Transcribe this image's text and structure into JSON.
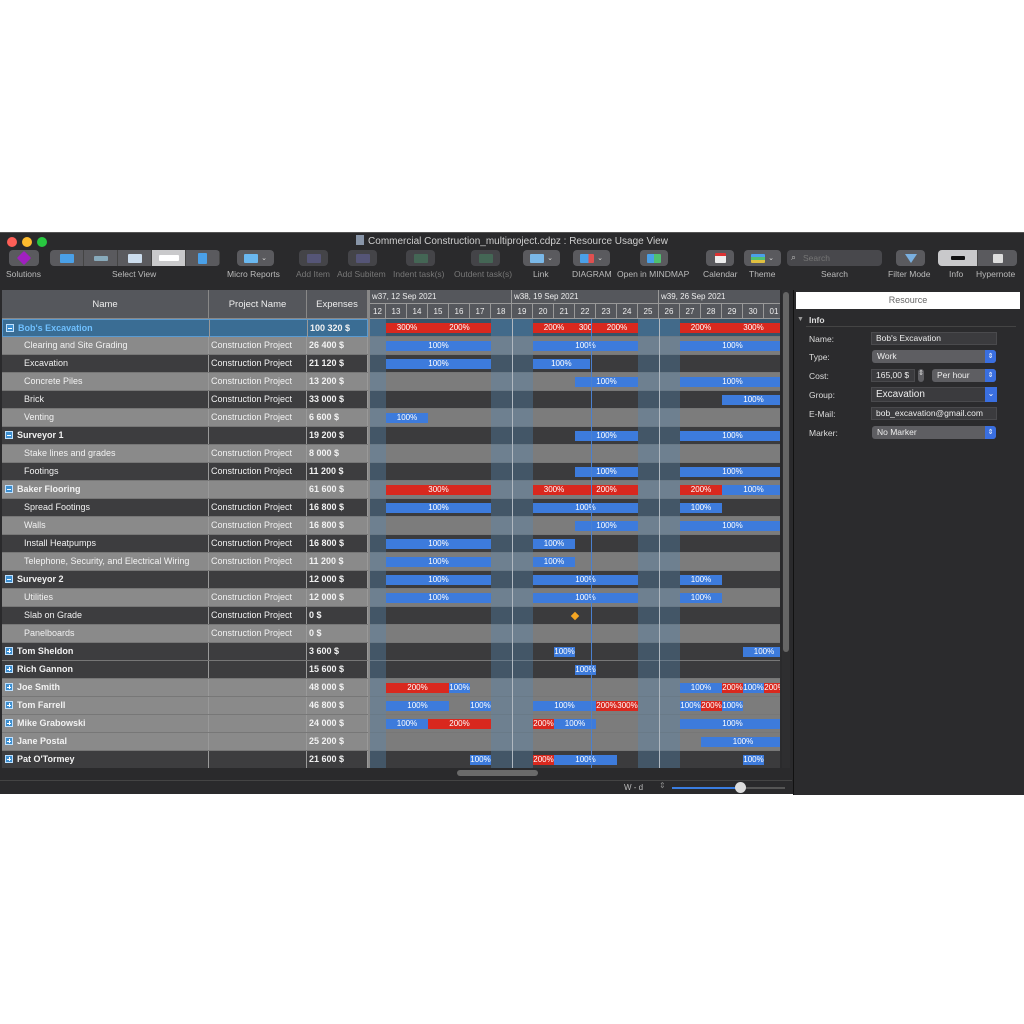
{
  "window": {
    "title": "Commercial Construction_multiproject.cdpz : Resource Usage View"
  },
  "toolbar": {
    "solutions": "Solutions",
    "select_view": "Select View",
    "micro_reports": "Micro Reports",
    "add_item": "Add Item",
    "add_subitem": "Add Subitem",
    "indent": "Indent task(s)",
    "outdent": "Outdent task(s)",
    "link": "Link",
    "diagram": "DIAGRAM",
    "mindmap": "Open in MINDMAP",
    "calendar": "Calendar",
    "theme": "Theme",
    "search_placeholder": "Search",
    "search": "Search",
    "filter_mode": "Filter Mode",
    "info": "Info",
    "hypernote": "Hypernote"
  },
  "colors": {
    "over": "#d9281e",
    "normal": "#3d7bdc",
    "selected": "#3a6d94",
    "accent": "#3a6fe0"
  },
  "table": {
    "headers": [
      "Name",
      "Project Name",
      "Expenses"
    ],
    "rows": [
      {
        "name": "Bob's Excavation",
        "project": "",
        "expenses": "100 320 $",
        "group": true,
        "expanded": true,
        "shade": "sel",
        "bars": [
          [
            1,
            3,
            "300%",
            "r"
          ],
          [
            3,
            6,
            "200%",
            "r"
          ],
          [
            8,
            10,
            "200%",
            "r"
          ],
          [
            10,
            11,
            "300",
            "r"
          ],
          [
            11,
            13,
            "200%",
            "r"
          ],
          [
            15,
            17,
            "200%",
            "r"
          ],
          [
            17,
            20,
            "300%",
            "r"
          ]
        ]
      },
      {
        "name": "Clearing and Site Grading",
        "project": "Construction Project",
        "expenses": "26 400 $",
        "shade": "light",
        "bars": [
          [
            1,
            6,
            "100%",
            "b"
          ],
          [
            8,
            13,
            "100%",
            "b"
          ],
          [
            15,
            20,
            "100%",
            "b"
          ]
        ]
      },
      {
        "name": "Excavation",
        "project": "Construction Project",
        "expenses": "21 120 $",
        "shade": "dark",
        "bars": [
          [
            1,
            6,
            "100%",
            "b"
          ],
          [
            8,
            10.7,
            "100%",
            "b"
          ]
        ]
      },
      {
        "name": "Concrete Piles",
        "project": "Construction Project",
        "expenses": "13 200 $",
        "shade": "light",
        "bars": [
          [
            10,
            13,
            "100%",
            "b"
          ],
          [
            15,
            20,
            "100%",
            "b"
          ]
        ]
      },
      {
        "name": "Brick",
        "project": "Construction Project",
        "expenses": "33 000 $",
        "shade": "dark",
        "bars": [
          [
            17,
            20,
            "100%",
            "b"
          ]
        ]
      },
      {
        "name": "Venting",
        "project": "Construction Project",
        "expenses": "6 600 $",
        "shade": "light",
        "bars": [
          [
            1,
            3,
            "100%",
            "b"
          ]
        ]
      },
      {
        "name": "Surveyor 1",
        "project": "",
        "expenses": "19 200 $",
        "group": true,
        "expanded": true,
        "shade": "dark",
        "bars": [
          [
            10,
            13,
            "100%",
            "b"
          ],
          [
            15,
            20,
            "100%",
            "b"
          ]
        ]
      },
      {
        "name": "Stake lines and grades",
        "project": "Construction Project",
        "expenses": "8 000 $",
        "shade": "light",
        "bars": []
      },
      {
        "name": "Footings",
        "project": "Construction Project",
        "expenses": "11 200 $",
        "shade": "dark",
        "bars": [
          [
            10,
            13,
            "100%",
            "b"
          ],
          [
            15,
            20,
            "100%",
            "b"
          ]
        ]
      },
      {
        "name": "Baker Flooring",
        "project": "",
        "expenses": "61 600 $",
        "group": true,
        "expanded": true,
        "shade": "light",
        "bars": [
          [
            1,
            6,
            "300%",
            "r"
          ],
          [
            8,
            10,
            "300%",
            "r"
          ],
          [
            10,
            13,
            "200%",
            "r"
          ],
          [
            15,
            17,
            "200%",
            "r"
          ],
          [
            17,
            20,
            "100%",
            "b"
          ]
        ]
      },
      {
        "name": "Spread Footings",
        "project": "Construction Project",
        "expenses": "16 800 $",
        "shade": "dark",
        "bars": [
          [
            1,
            6,
            "100%",
            "b"
          ],
          [
            8,
            13,
            "100%",
            "b"
          ],
          [
            15,
            17,
            "100%",
            "b"
          ]
        ]
      },
      {
        "name": "Walls",
        "project": "Construction Project",
        "expenses": "16 800 $",
        "shade": "light",
        "bars": [
          [
            10,
            13,
            "100%",
            "b"
          ],
          [
            15,
            20,
            "100%",
            "b"
          ]
        ]
      },
      {
        "name": "Install Heatpumps",
        "project": "Construction Project",
        "expenses": "16 800 $",
        "shade": "dark",
        "bars": [
          [
            1,
            6,
            "100%",
            "b"
          ],
          [
            8,
            10,
            "100%",
            "b"
          ]
        ]
      },
      {
        "name": "Telephone, Security, and Electrical Wiring",
        "project": "Construction Project",
        "expenses": "11 200 $",
        "shade": "light",
        "bars": [
          [
            1,
            6,
            "100%",
            "b"
          ],
          [
            8,
            10,
            "100%",
            "b"
          ]
        ]
      },
      {
        "name": "Surveyor 2",
        "project": "",
        "expenses": "12 000 $",
        "group": true,
        "expanded": true,
        "shade": "dark",
        "bars": [
          [
            1,
            6,
            "100%",
            "b"
          ],
          [
            8,
            13,
            "100%",
            "b"
          ],
          [
            15,
            17,
            "100%",
            "b"
          ]
        ]
      },
      {
        "name": "Utilities",
        "project": "Construction Project",
        "expenses": "12 000 $",
        "shade": "light",
        "bars": [
          [
            1,
            6,
            "100%",
            "b"
          ],
          [
            8,
            13,
            "100%",
            "b"
          ],
          [
            15,
            17,
            "100%",
            "b"
          ]
        ]
      },
      {
        "name": "Slab on Grade",
        "project": "Construction Project",
        "expenses": "0 $",
        "shade": "dark",
        "bars": [],
        "milestone": 10
      },
      {
        "name": "Panelboards",
        "project": "Construction Project",
        "expenses": "0 $",
        "shade": "light",
        "bars": []
      },
      {
        "name": "Tom Sheldon",
        "project": "",
        "expenses": "3 600 $",
        "group": true,
        "shade": "dark",
        "bars": [
          [
            9,
            10,
            "100%",
            "b"
          ],
          [
            18,
            20,
            "100%",
            "b"
          ]
        ]
      },
      {
        "name": "Rich Gannon",
        "project": "",
        "expenses": "15 600 $",
        "group": true,
        "shade": "dark",
        "bars": [
          [
            10,
            11,
            "100%",
            "b"
          ]
        ]
      },
      {
        "name": "Joe Smith",
        "project": "",
        "expenses": "48 000 $",
        "group": true,
        "shade": "light",
        "bars": [
          [
            1,
            4,
            "200%",
            "r"
          ],
          [
            4,
            5,
            "100%",
            "b"
          ],
          [
            15,
            17,
            "100%",
            "b"
          ],
          [
            17,
            18,
            "200%",
            "r"
          ],
          [
            18,
            19,
            "100%",
            "b"
          ],
          [
            19,
            20,
            "200%",
            "r"
          ]
        ]
      },
      {
        "name": "Tom Farrell",
        "project": "",
        "expenses": "46 800 $",
        "group": true,
        "shade": "light",
        "bars": [
          [
            1,
            4,
            "100%",
            "b"
          ],
          [
            5,
            6,
            "100%",
            "b"
          ],
          [
            8,
            11,
            "100%",
            "b"
          ],
          [
            11,
            12,
            "200%",
            "r"
          ],
          [
            12,
            13,
            "300%",
            "r"
          ],
          [
            15,
            16,
            "100%",
            "b"
          ],
          [
            16,
            17,
            "200%",
            "r"
          ],
          [
            17,
            18,
            "100%",
            "b"
          ]
        ]
      },
      {
        "name": "Mike Grabowski",
        "project": "",
        "expenses": "24 000 $",
        "group": true,
        "shade": "light",
        "bars": [
          [
            1,
            3,
            "100%",
            "b"
          ],
          [
            3,
            6,
            "200%",
            "r"
          ],
          [
            8,
            9,
            "200%",
            "r"
          ],
          [
            9,
            11,
            "100%",
            "b"
          ],
          [
            15,
            20,
            "100%",
            "b"
          ]
        ]
      },
      {
        "name": "Jane Postal",
        "project": "",
        "expenses": "25 200 $",
        "group": true,
        "shade": "light",
        "bars": [
          [
            16,
            20,
            "100%",
            "b"
          ]
        ]
      },
      {
        "name": "Pat O'Tormey",
        "project": "",
        "expenses": "21 600 $",
        "group": true,
        "shade": "dark",
        "bars": [
          [
            5,
            6,
            "100%",
            "b"
          ],
          [
            8,
            9,
            "200%",
            "r"
          ],
          [
            9,
            12,
            "100%",
            "b"
          ],
          [
            18,
            19,
            "100%",
            "b"
          ]
        ]
      }
    ]
  },
  "timeline": {
    "weeks": [
      "w37, 12 Sep 2021",
      "w38, 19 Sep 2021",
      "w39, 26 Sep 2021"
    ],
    "days": [
      "12",
      "13",
      "14",
      "15",
      "16",
      "17",
      "18",
      "19",
      "20",
      "21",
      "22",
      "23",
      "24",
      "25",
      "26",
      "27",
      "28",
      "29",
      "30",
      "01"
    ],
    "weekend_days": [
      "12",
      "18",
      "19",
      "25",
      "26"
    ],
    "today_day": "22"
  },
  "status": {
    "scale": "W - d",
    "zoom_level": 0.6
  },
  "panel": {
    "tab": "Resource",
    "section": "Info",
    "name_label": "Name:",
    "name": "Bob's Excavation",
    "type_label": "Type:",
    "type": "Work",
    "cost_label": "Cost:",
    "cost": "165,00 $",
    "cost_unit": "Per hour",
    "group_label": "Group:",
    "group": "Excavation",
    "email_label": "E-Mail:",
    "email": "bob_excavation@gmail.com",
    "marker_label": "Marker:",
    "marker": "No Marker"
  }
}
